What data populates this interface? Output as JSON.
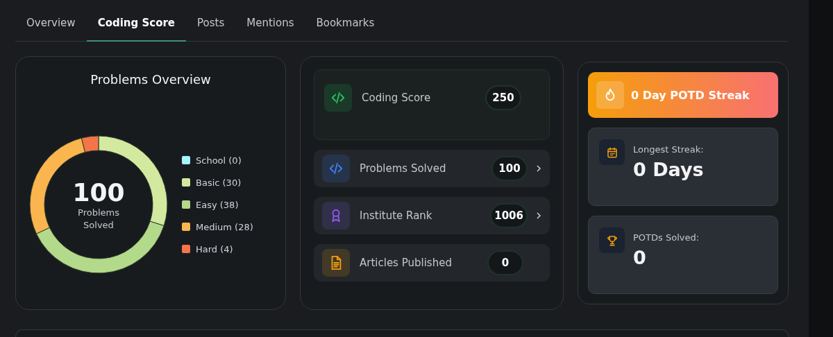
{
  "tabs": [
    {
      "label": "Overview",
      "selected": false
    },
    {
      "label": "Coding Score",
      "selected": true
    },
    {
      "label": "Posts",
      "selected": false
    },
    {
      "label": "Mentions",
      "selected": false
    },
    {
      "label": "Bookmarks",
      "selected": false
    }
  ],
  "problems_overview": {
    "title": "Problems Overview",
    "total": "100",
    "total_label": "Problems Solved",
    "chart_data": {
      "type": "donut",
      "values": [
        0,
        30,
        38,
        28,
        4
      ]
    },
    "legend": [
      {
        "label": "School (0)",
        "color": "#a5f3fc"
      },
      {
        "label": "Basic (30)",
        "color": "#d4e9a0"
      },
      {
        "label": "Easy (38)",
        "color": "#b3d98a"
      },
      {
        "label": "Medium (28)",
        "color": "#fbb54e"
      },
      {
        "label": "Hard (4)",
        "color": "#f4754a"
      }
    ]
  },
  "stats": [
    {
      "kind": "highlight",
      "color": "#22c55e",
      "label": "Coding Score",
      "value": "250",
      "chevron": false
    },
    {
      "kind": "row",
      "color": "#3b82f6",
      "label": "Problems Solved",
      "value": "100",
      "chevron": true
    },
    {
      "kind": "row",
      "color": "#8b5cf6",
      "label": "Institute Rank",
      "value": "1006",
      "chevron": true
    },
    {
      "kind": "row",
      "color": "#f59e0b",
      "label": "Articles Published",
      "value": "0",
      "chevron": false
    }
  ],
  "potd": {
    "streak": "0 Day POTD Streak",
    "cards": [
      {
        "label": "Longest Streak:",
        "value": "0 Days"
      },
      {
        "label": "POTDs Solved:",
        "value": "0"
      }
    ]
  }
}
